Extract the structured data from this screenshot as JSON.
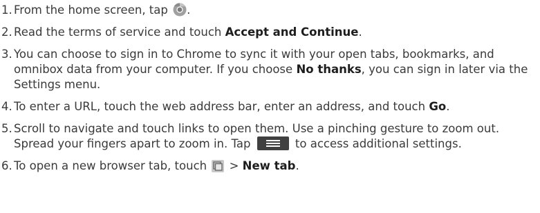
{
  "steps": [
    {
      "num": "1.",
      "t1": "From the home screen, tap ",
      "icon": "chrome-app-icon",
      "t2": "."
    },
    {
      "num": "2.",
      "t1": "Read the terms of service and touch ",
      "b1": "Accept and Continue",
      "t2": "."
    },
    {
      "num": "3.",
      "t1": "You can choose to sign in to Chrome to sync it with your open tabs, bookmarks, and omnibox data from your computer. If you choose ",
      "b1": "No thanks",
      "t2": ", you can sign in later via the Settings menu."
    },
    {
      "num": "4.",
      "t1": "To enter a URL, touch the web address bar, enter an address, and touch ",
      "b1": "Go",
      "t2": "."
    },
    {
      "num": "5.",
      "t1": "Scroll to navigate and touch links to open them. Use a pinching gesture to zoom out. Spread your fingers apart to zoom in. Tap ",
      "icon": "menu-icon",
      "t2": " to access additional settings."
    },
    {
      "num": "6.",
      "t1": "To open a new browser tab, touch ",
      "icon": "tabs-icon",
      "t2": " > ",
      "b1": "New tab",
      "t3": "."
    }
  ]
}
